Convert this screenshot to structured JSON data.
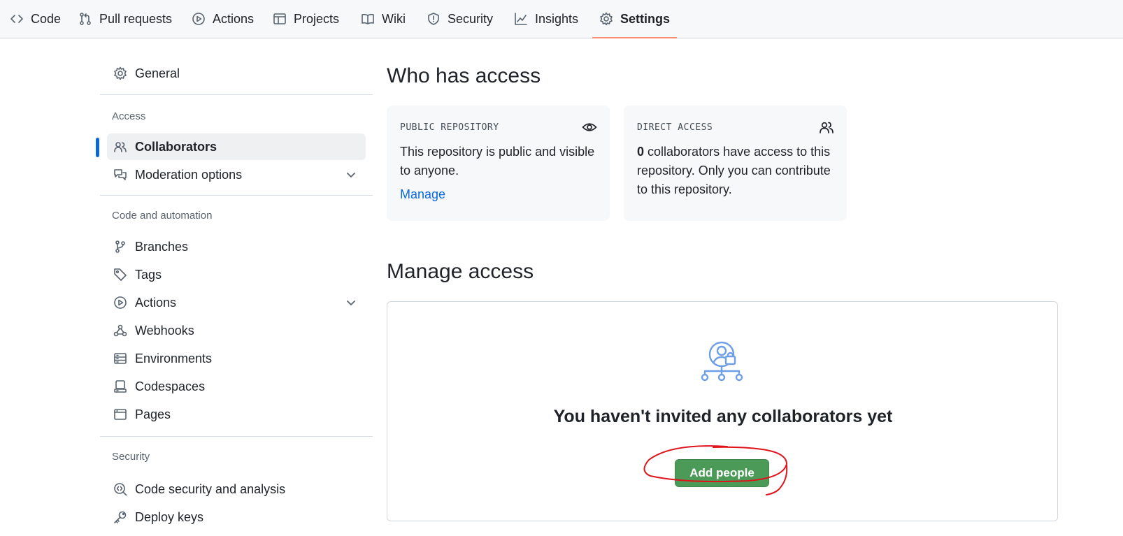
{
  "repo_nav": {
    "tabs": [
      {
        "label": "Code",
        "icon": "code-icon"
      },
      {
        "label": "Pull requests",
        "icon": "git-pull-request-icon"
      },
      {
        "label": "Actions",
        "icon": "play-icon"
      },
      {
        "label": "Projects",
        "icon": "table-icon"
      },
      {
        "label": "Wiki",
        "icon": "book-icon"
      },
      {
        "label": "Security",
        "icon": "shield-icon"
      },
      {
        "label": "Insights",
        "icon": "graph-icon"
      },
      {
        "label": "Settings",
        "icon": "gear-icon",
        "active": true
      }
    ]
  },
  "sidebar": {
    "general": "General",
    "access_heading": "Access",
    "access_items": [
      {
        "label": "Collaborators",
        "icon": "people-icon",
        "active": true
      },
      {
        "label": "Moderation options",
        "icon": "comment-discussion-icon",
        "expandable": true
      }
    ],
    "code_heading": "Code and automation",
    "code_items": [
      {
        "label": "Branches",
        "icon": "git-branch-icon"
      },
      {
        "label": "Tags",
        "icon": "tag-icon"
      },
      {
        "label": "Actions",
        "icon": "play-icon",
        "expandable": true
      },
      {
        "label": "Webhooks",
        "icon": "webhook-icon"
      },
      {
        "label": "Environments",
        "icon": "server-icon"
      },
      {
        "label": "Codespaces",
        "icon": "codespaces-icon"
      },
      {
        "label": "Pages",
        "icon": "browser-icon"
      }
    ],
    "security_heading": "Security",
    "security_items": [
      {
        "label": "Code security and analysis",
        "icon": "codescan-icon"
      },
      {
        "label": "Deploy keys",
        "icon": "key-icon"
      }
    ]
  },
  "who_has_access": {
    "title": "Who has access",
    "public_card": {
      "label": "PUBLIC REPOSITORY",
      "icon": "eye-icon",
      "text": "This repository is public and visible to anyone.",
      "link": "Manage"
    },
    "direct_card": {
      "label": "DIRECT ACCESS",
      "icon": "people-icon",
      "count": "0",
      "text": " collaborators have access to this repository. Only you can contribute to this repository."
    }
  },
  "manage_access": {
    "title": "Manage access",
    "empty_icon": "person-lock-org-icon",
    "empty_title": "You haven't invited any collaborators yet",
    "add_button": "Add people"
  },
  "colors": {
    "accent_link": "#0969da",
    "add_button": "#4c9a57",
    "active_tab_underline": "#fd8c73",
    "annotation_circle": "#e0131b"
  }
}
